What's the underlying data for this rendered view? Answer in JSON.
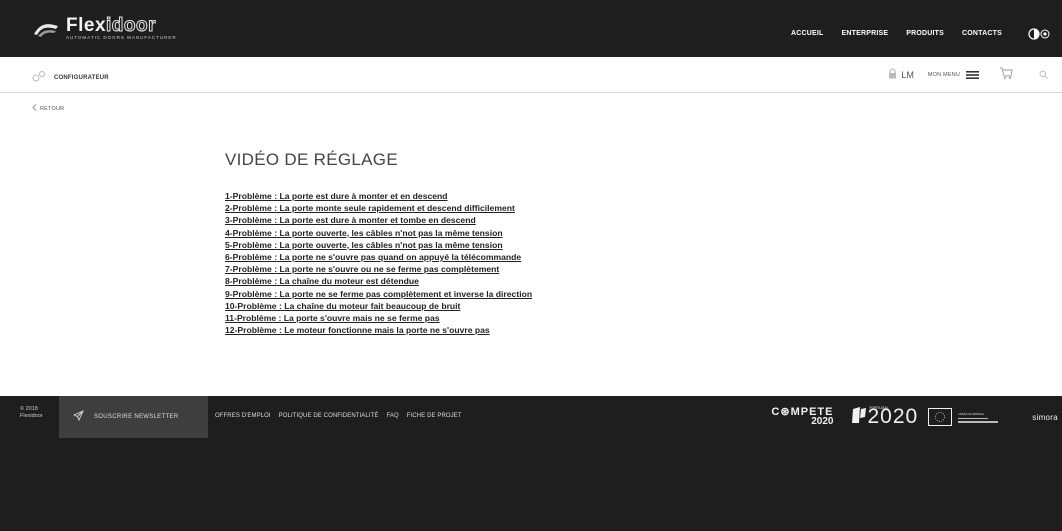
{
  "header": {
    "brand": {
      "word_part1": "Flex",
      "word_part2": "idoor",
      "tagline": "AUTOMATIC DOORS MANUFACTURER"
    },
    "nav": [
      "ACCUEIL",
      "ENTERPRISE",
      "PRODUITS",
      "CONTACTS"
    ]
  },
  "subbar": {
    "configurator_label": "CONFIGURATEUR",
    "user_initials": "LM",
    "menu_label": "MON MENU"
  },
  "back_label": "RETOUR",
  "page_title": "VIDÉO DE RÉGLAGE",
  "problems": [
    "1-Problème : La porte est dure à monter et en descend",
    "2-Problème : La porte monte seule rapidement et descend difficilement",
    "3-Problème : La porte est dure à monter et tombe en descend",
    "4-Problème : La porte ouverte, les câbles n'not pas la même tension",
    "5-Problème : La porte ouverte, les câbles n'not pas la même tension",
    "6-Problème : La porte ne s'ouvre pas quand on appuyé la télécommande",
    "7-Problème : La porte ne s'ouvre ou ne se ferme pas complètement",
    "8-Problème : La chaîne du moteur est détendue",
    "9-Problème : La porte ne se ferme pas complètement et inverse la direction",
    "10-Problème : La chaîne du moteur fait beaucoup de bruit",
    "11-Problème : La porte s'ouvre mais ne se ferme pas",
    "12-Problème : Le moteur fonctionne mais la porte ne s'ouvre pas"
  ],
  "footer": {
    "copyright_line1": "© 2018",
    "copyright_line2": "Flexidoor",
    "newsletter_label": "SOUSCRIRE NEWSLETTER",
    "links": [
      "OFFRES D'EMPLOI",
      "POLITIQUE DE CONFIDENTIALITÉ",
      "FAQ",
      "FICHE DE PROJET"
    ],
    "compete_line1": "C⊛MPETE",
    "compete_line2": "2020",
    "portugal_small": "PORTUGAL",
    "portugal_2020": "2020",
    "eu_small": "UNIÃO EUROPEIA",
    "agency": "simora"
  },
  "colors": {
    "header_bg": "#1e1e1e",
    "newsletter_bg": "#3e3e3e",
    "text_dark": "#222222"
  },
  "icons": [
    "flexidoor-logo-icon",
    "contrast-toggle-icon",
    "configurator-icon",
    "lock-icon",
    "hamburger-icon",
    "cart-icon",
    "search-icon",
    "chevron-left-icon",
    "paper-plane-icon",
    "eu-flag-icon"
  ]
}
